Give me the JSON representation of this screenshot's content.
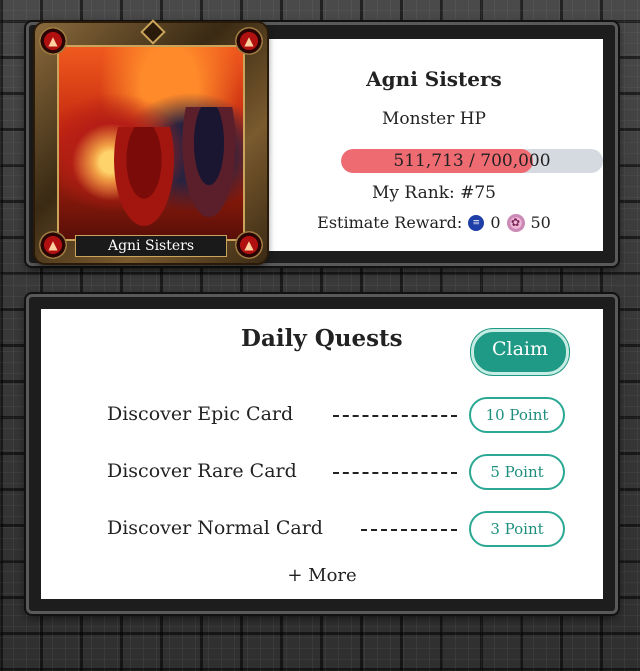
{
  "boss": {
    "card_name": "Agni Sisters",
    "title": "Agni Sisters",
    "hp_label": "Monster HP",
    "hp_current": 511713,
    "hp_max": 700000,
    "hp_text": "511,713 / 700,000",
    "rank_text": "My Rank: #75",
    "reward_label": "Estimate Reward:",
    "reward_coin_value": "0",
    "reward_fairy_value": "50",
    "hp_fill_color": "#ef6b72",
    "hp_track_color": "#d5d9e0"
  },
  "quests": {
    "title": "Daily Quests",
    "claim_label": "Claim",
    "items": [
      {
        "label": "Discover Epic Card",
        "points": "10 Point"
      },
      {
        "label": "Discover Rare Card",
        "points": "5 Point"
      },
      {
        "label": "Discover Normal Card",
        "points": "3 Point"
      }
    ],
    "more_label": "+ More",
    "accent_color": "#1f9a86"
  },
  "icons": {
    "coin": "coin-icon",
    "fairy": "fairy-token-icon",
    "flame": "flame-icon"
  }
}
